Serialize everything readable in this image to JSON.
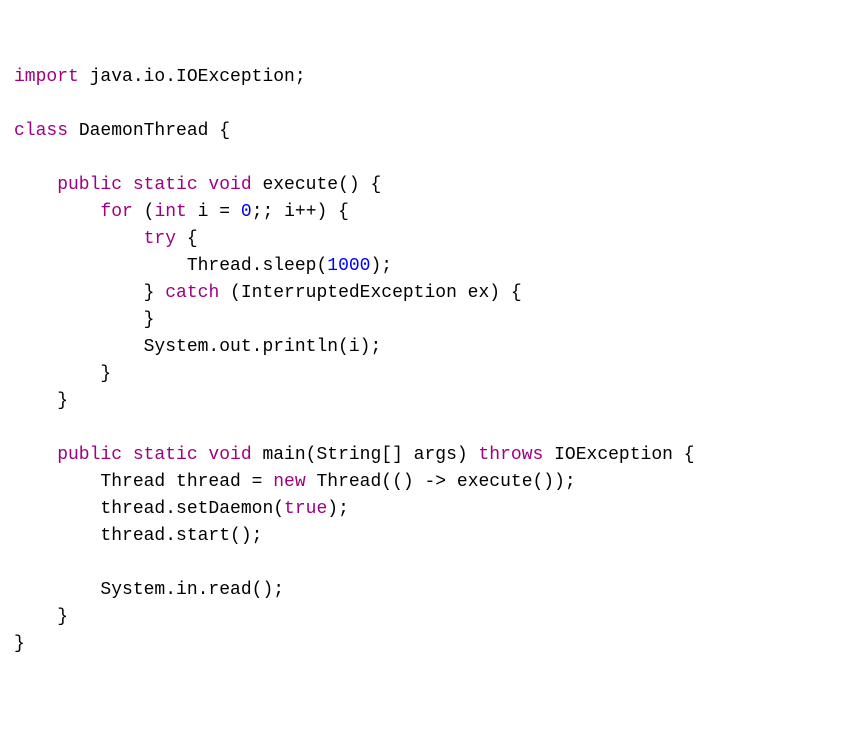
{
  "code": {
    "tokens": [
      {
        "t": "import ",
        "c": "kw"
      },
      {
        "t": "java.io.IOException;\n\n",
        "c": "ident"
      },
      {
        "t": "class ",
        "c": "kw"
      },
      {
        "t": "DaemonThread {\n\n",
        "c": "ident"
      },
      {
        "t": "    public static void ",
        "c": "kw"
      },
      {
        "t": "execute() {\n",
        "c": "ident"
      },
      {
        "t": "        for ",
        "c": "kw"
      },
      {
        "t": "(",
        "c": "ident"
      },
      {
        "t": "int ",
        "c": "kw"
      },
      {
        "t": "i = ",
        "c": "ident"
      },
      {
        "t": "0",
        "c": "num"
      },
      {
        "t": ";; i++) {\n",
        "c": "ident"
      },
      {
        "t": "            try ",
        "c": "kw"
      },
      {
        "t": "{\n                Thread.sleep(",
        "c": "ident"
      },
      {
        "t": "1000",
        "c": "num"
      },
      {
        "t": ");\n            } ",
        "c": "ident"
      },
      {
        "t": "catch ",
        "c": "kw"
      },
      {
        "t": "(InterruptedException ex) {\n            }\n            System.out.println(i);\n        }\n    }\n\n",
        "c": "ident"
      },
      {
        "t": "    public static void ",
        "c": "kw"
      },
      {
        "t": "main(String[] args) ",
        "c": "ident"
      },
      {
        "t": "throws ",
        "c": "kw"
      },
      {
        "t": "IOException {\n        Thread thread = ",
        "c": "ident"
      },
      {
        "t": "new ",
        "c": "kw"
      },
      {
        "t": "Thread(() -> execute());\n        thread.setDaemon(",
        "c": "ident"
      },
      {
        "t": "true",
        "c": "kw"
      },
      {
        "t": ");\n        thread.start();\n\n        System.in.read();\n    }\n}",
        "c": "ident"
      }
    ]
  }
}
